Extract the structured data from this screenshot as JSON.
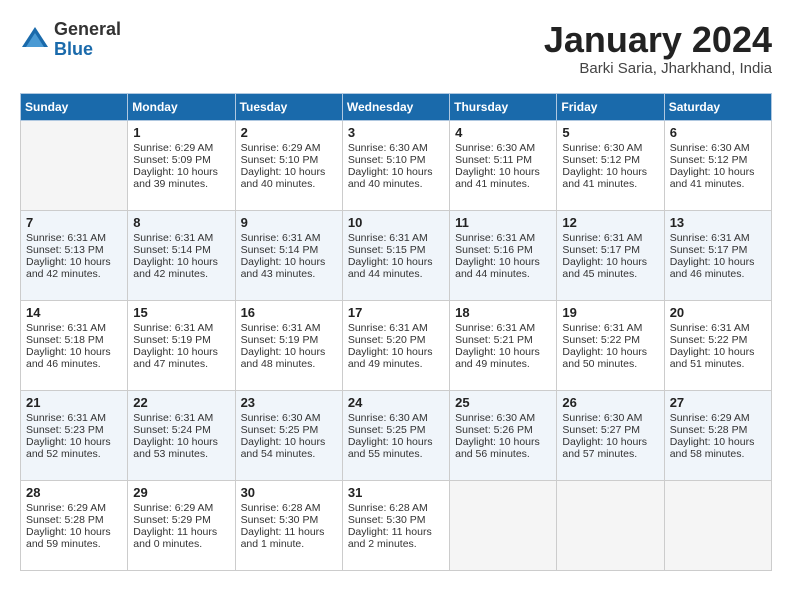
{
  "header": {
    "logo_general": "General",
    "logo_blue": "Blue",
    "title": "January 2024",
    "location": "Barki Saria, Jharkhand, India"
  },
  "days_of_week": [
    "Sunday",
    "Monday",
    "Tuesday",
    "Wednesday",
    "Thursday",
    "Friday",
    "Saturday"
  ],
  "weeks": [
    [
      {
        "day": "",
        "sunrise": "",
        "sunset": "",
        "daylight": ""
      },
      {
        "day": "1",
        "sunrise": "Sunrise: 6:29 AM",
        "sunset": "Sunset: 5:09 PM",
        "daylight": "Daylight: 10 hours and 39 minutes."
      },
      {
        "day": "2",
        "sunrise": "Sunrise: 6:29 AM",
        "sunset": "Sunset: 5:10 PM",
        "daylight": "Daylight: 10 hours and 40 minutes."
      },
      {
        "day": "3",
        "sunrise": "Sunrise: 6:30 AM",
        "sunset": "Sunset: 5:10 PM",
        "daylight": "Daylight: 10 hours and 40 minutes."
      },
      {
        "day": "4",
        "sunrise": "Sunrise: 6:30 AM",
        "sunset": "Sunset: 5:11 PM",
        "daylight": "Daylight: 10 hours and 41 minutes."
      },
      {
        "day": "5",
        "sunrise": "Sunrise: 6:30 AM",
        "sunset": "Sunset: 5:12 PM",
        "daylight": "Daylight: 10 hours and 41 minutes."
      },
      {
        "day": "6",
        "sunrise": "Sunrise: 6:30 AM",
        "sunset": "Sunset: 5:12 PM",
        "daylight": "Daylight: 10 hours and 41 minutes."
      }
    ],
    [
      {
        "day": "7",
        "sunrise": "Sunrise: 6:31 AM",
        "sunset": "Sunset: 5:13 PM",
        "daylight": "Daylight: 10 hours and 42 minutes."
      },
      {
        "day": "8",
        "sunrise": "Sunrise: 6:31 AM",
        "sunset": "Sunset: 5:14 PM",
        "daylight": "Daylight: 10 hours and 42 minutes."
      },
      {
        "day": "9",
        "sunrise": "Sunrise: 6:31 AM",
        "sunset": "Sunset: 5:14 PM",
        "daylight": "Daylight: 10 hours and 43 minutes."
      },
      {
        "day": "10",
        "sunrise": "Sunrise: 6:31 AM",
        "sunset": "Sunset: 5:15 PM",
        "daylight": "Daylight: 10 hours and 44 minutes."
      },
      {
        "day": "11",
        "sunrise": "Sunrise: 6:31 AM",
        "sunset": "Sunset: 5:16 PM",
        "daylight": "Daylight: 10 hours and 44 minutes."
      },
      {
        "day": "12",
        "sunrise": "Sunrise: 6:31 AM",
        "sunset": "Sunset: 5:17 PM",
        "daylight": "Daylight: 10 hours and 45 minutes."
      },
      {
        "day": "13",
        "sunrise": "Sunrise: 6:31 AM",
        "sunset": "Sunset: 5:17 PM",
        "daylight": "Daylight: 10 hours and 46 minutes."
      }
    ],
    [
      {
        "day": "14",
        "sunrise": "Sunrise: 6:31 AM",
        "sunset": "Sunset: 5:18 PM",
        "daylight": "Daylight: 10 hours and 46 minutes."
      },
      {
        "day": "15",
        "sunrise": "Sunrise: 6:31 AM",
        "sunset": "Sunset: 5:19 PM",
        "daylight": "Daylight: 10 hours and 47 minutes."
      },
      {
        "day": "16",
        "sunrise": "Sunrise: 6:31 AM",
        "sunset": "Sunset: 5:19 PM",
        "daylight": "Daylight: 10 hours and 48 minutes."
      },
      {
        "day": "17",
        "sunrise": "Sunrise: 6:31 AM",
        "sunset": "Sunset: 5:20 PM",
        "daylight": "Daylight: 10 hours and 49 minutes."
      },
      {
        "day": "18",
        "sunrise": "Sunrise: 6:31 AM",
        "sunset": "Sunset: 5:21 PM",
        "daylight": "Daylight: 10 hours and 49 minutes."
      },
      {
        "day": "19",
        "sunrise": "Sunrise: 6:31 AM",
        "sunset": "Sunset: 5:22 PM",
        "daylight": "Daylight: 10 hours and 50 minutes."
      },
      {
        "day": "20",
        "sunrise": "Sunrise: 6:31 AM",
        "sunset": "Sunset: 5:22 PM",
        "daylight": "Daylight: 10 hours and 51 minutes."
      }
    ],
    [
      {
        "day": "21",
        "sunrise": "Sunrise: 6:31 AM",
        "sunset": "Sunset: 5:23 PM",
        "daylight": "Daylight: 10 hours and 52 minutes."
      },
      {
        "day": "22",
        "sunrise": "Sunrise: 6:31 AM",
        "sunset": "Sunset: 5:24 PM",
        "daylight": "Daylight: 10 hours and 53 minutes."
      },
      {
        "day": "23",
        "sunrise": "Sunrise: 6:30 AM",
        "sunset": "Sunset: 5:25 PM",
        "daylight": "Daylight: 10 hours and 54 minutes."
      },
      {
        "day": "24",
        "sunrise": "Sunrise: 6:30 AM",
        "sunset": "Sunset: 5:25 PM",
        "daylight": "Daylight: 10 hours and 55 minutes."
      },
      {
        "day": "25",
        "sunrise": "Sunrise: 6:30 AM",
        "sunset": "Sunset: 5:26 PM",
        "daylight": "Daylight: 10 hours and 56 minutes."
      },
      {
        "day": "26",
        "sunrise": "Sunrise: 6:30 AM",
        "sunset": "Sunset: 5:27 PM",
        "daylight": "Daylight: 10 hours and 57 minutes."
      },
      {
        "day": "27",
        "sunrise": "Sunrise: 6:29 AM",
        "sunset": "Sunset: 5:28 PM",
        "daylight": "Daylight: 10 hours and 58 minutes."
      }
    ],
    [
      {
        "day": "28",
        "sunrise": "Sunrise: 6:29 AM",
        "sunset": "Sunset: 5:28 PM",
        "daylight": "Daylight: 10 hours and 59 minutes."
      },
      {
        "day": "29",
        "sunrise": "Sunrise: 6:29 AM",
        "sunset": "Sunset: 5:29 PM",
        "daylight": "Daylight: 11 hours and 0 minutes."
      },
      {
        "day": "30",
        "sunrise": "Sunrise: 6:28 AM",
        "sunset": "Sunset: 5:30 PM",
        "daylight": "Daylight: 11 hours and 1 minute."
      },
      {
        "day": "31",
        "sunrise": "Sunrise: 6:28 AM",
        "sunset": "Sunset: 5:30 PM",
        "daylight": "Daylight: 11 hours and 2 minutes."
      },
      {
        "day": "",
        "sunrise": "",
        "sunset": "",
        "daylight": ""
      },
      {
        "day": "",
        "sunrise": "",
        "sunset": "",
        "daylight": ""
      },
      {
        "day": "",
        "sunrise": "",
        "sunset": "",
        "daylight": ""
      }
    ]
  ]
}
